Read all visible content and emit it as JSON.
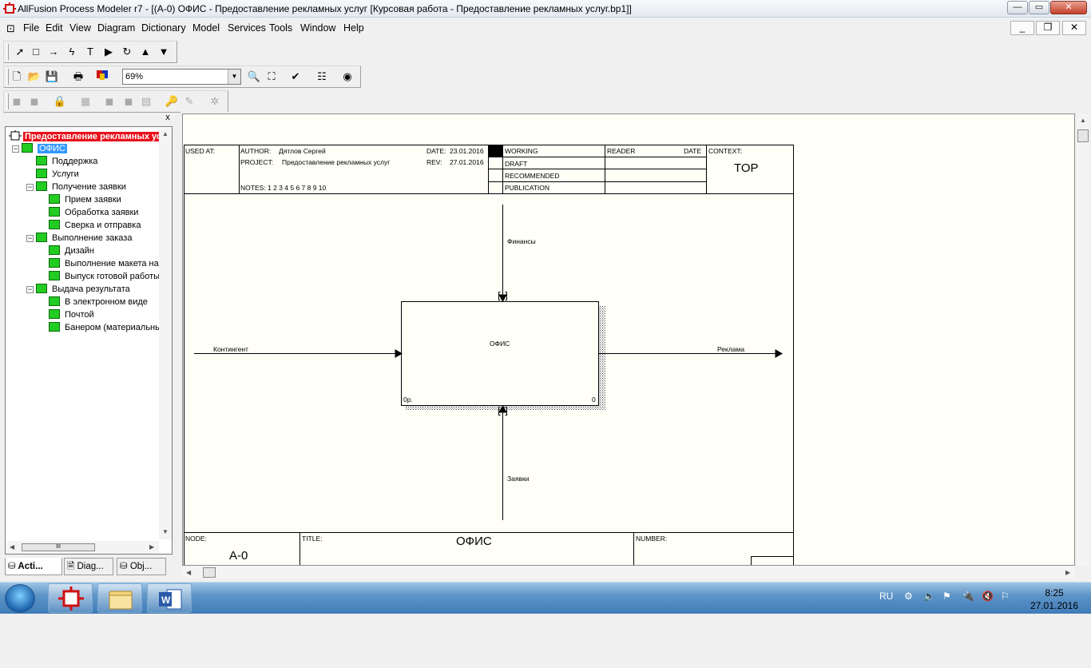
{
  "window": {
    "title": "AllFusion Process Modeler r7 - [(A-0) ОФИС   - Предоставление рекламных услуг  [Курсовая работа - Предоставление рекламных услуг.bp1]]",
    "minimize": "—",
    "maximize": "▭",
    "close": "✕"
  },
  "menu": {
    "items": [
      "File",
      "Edit",
      "View",
      "Diagram",
      "Dictionary",
      "Model",
      "Services",
      "Tools",
      "Window",
      "Help"
    ],
    "mdi_minimize": "_",
    "mdi_restore": "❐",
    "mdi_close": "✕"
  },
  "toolbar": {
    "zoom_value": "69%"
  },
  "explorer": {
    "close": "x",
    "root": "Предоставление рекламных услуг",
    "selected": "ОФИС",
    "items": [
      {
        "label": "Поддержка",
        "level": 1,
        "expander": ""
      },
      {
        "label": "Услуги",
        "level": 1,
        "expander": ""
      },
      {
        "label": "Получение  заявки",
        "level": 1,
        "expander": "−"
      },
      {
        "label": "Прием заявки",
        "level": 2,
        "expander": ""
      },
      {
        "label": "Обработка заявки",
        "level": 2,
        "expander": ""
      },
      {
        "label": "Сверка и отправка",
        "level": 2,
        "expander": ""
      },
      {
        "label": "Выполнение  заказа",
        "level": 1,
        "expander": "−"
      },
      {
        "label": "Дизайн",
        "level": 2,
        "expander": ""
      },
      {
        "label": "Выполнение макета на",
        "level": 2,
        "expander": ""
      },
      {
        "label": "Выпуск готовой работы",
        "level": 2,
        "expander": ""
      },
      {
        "label": "Выдача  результата",
        "level": 1,
        "expander": "−"
      },
      {
        "label": "В электронном виде",
        "level": 2,
        "expander": ""
      },
      {
        "label": "Почтой",
        "level": 2,
        "expander": ""
      },
      {
        "label": "Банером (материальные",
        "level": 2,
        "expander": ""
      }
    ],
    "hscroll_thumb": "III",
    "tabs": [
      "Acti...",
      "Diag...",
      "Obj..."
    ]
  },
  "header": {
    "used_at": "USED AT:",
    "author_label": "AUTHOR:",
    "author": "Дятлов Сергей",
    "project_label": "PROJECT:",
    "project": "Предоставление рекламных услуг",
    "notes": "NOTES:  1  2  3  4  5  6  7  8  9  10",
    "date_label": "DATE:",
    "date": "23.01.2016",
    "rev_label": "REV:",
    "rev": "27.01.2016",
    "status": [
      "WORKING",
      "DRAFT",
      "RECOMMENDED",
      "PUBLICATION"
    ],
    "reader": "READER",
    "reader_date": "DATE",
    "context_label": "CONTEXT:",
    "context": "TOP"
  },
  "diagram": {
    "box_label": "ОФИС",
    "box_cost": "0р.",
    "box_number": "0",
    "arrows": {
      "control": "Финансы",
      "input": "Контингент",
      "output": "Реклама",
      "mechanism": "Заявки"
    }
  },
  "footer": {
    "node_label": "NODE:",
    "node": "A-0",
    "title_label": "TITLE:",
    "title": "ОФИС",
    "number_label": "NUMBER:"
  },
  "taskbar": {
    "lang": "RU",
    "time": "8:25",
    "date": "27.01.2016"
  }
}
